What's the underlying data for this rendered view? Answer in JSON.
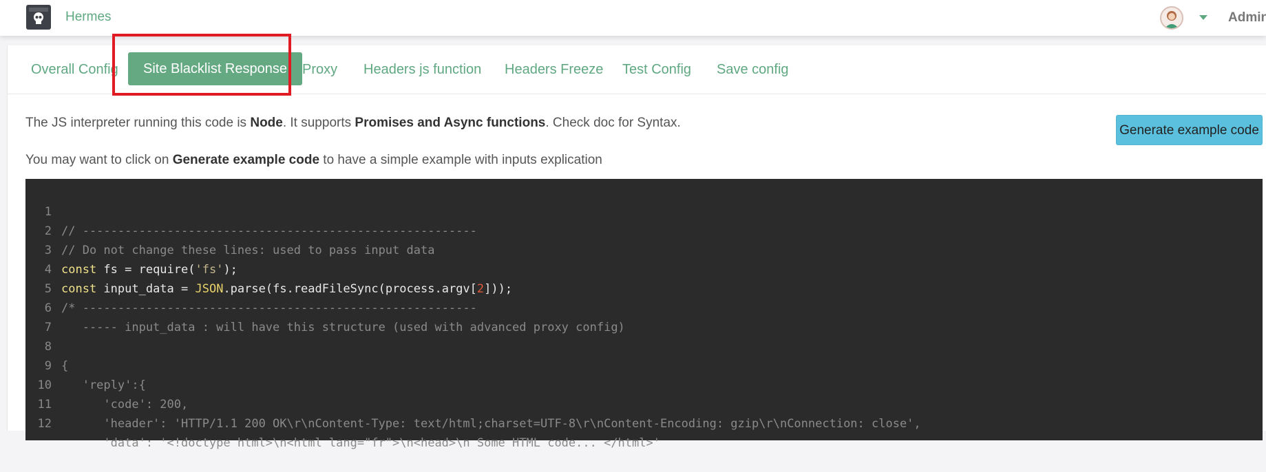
{
  "header": {
    "app_name": "Hermes",
    "user_name": "Admin"
  },
  "tabs": [
    {
      "label": "Overall Config"
    },
    {
      "label": "Site Blacklist Response",
      "active": true
    },
    {
      "label": "Proxy"
    },
    {
      "label": "Headers js function"
    },
    {
      "label": "Headers Freeze"
    },
    {
      "label": "Test Config"
    },
    {
      "label": "Save config"
    }
  ],
  "intro": {
    "line1_a": "The JS interpreter running this code is ",
    "line1_b": "Node",
    "line1_c": ". It supports ",
    "line1_d": "Promises and Async functions",
    "line1_e": ". Check doc for Syntax.",
    "line2_a": "You may want to click on ",
    "line2_b": "Generate example code",
    "line2_c": " to have a simple example with inputs explication"
  },
  "generate_button": "Generate example code",
  "code": {
    "line_numbers": [
      "1",
      "2",
      "3",
      "4",
      "5",
      "6",
      "7",
      "8",
      "9",
      "10",
      "11",
      "12"
    ],
    "l1": "// --------------------------------------------------------",
    "l2": "// Do not change these lines: used to pass input data",
    "l3_kw": "const",
    "l3_a": " fs = require(",
    "l3_str": "'fs'",
    "l3_b": ");",
    "l4_kw": "const",
    "l4_a": " input_data = ",
    "l4_json": "JSON",
    "l4_b": ".parse(fs.readFileSync(process.argv[",
    "l4_num": "2",
    "l4_c": "]));",
    "l5": "/* --------------------------------------------------------",
    "l6": "   ----- input_data : will have this structure (used with advanced proxy config)",
    "l7": "",
    "l8": "{",
    "l9": "   'reply':{",
    "l10": "      'code': 200,",
    "l11": "      'header': 'HTTP/1.1 200 OK\\r\\nContent-Type: text/html;charset=UTF-8\\r\\nContent-Encoding: gzip\\r\\nConnection: close',",
    "l12": "      'data': '<!doctype html>\\n<html lang=\"fr\">\\n<head>\\n Some HTML code... </html>'"
  },
  "colors": {
    "accent": "#5fa882",
    "active_tab_bg": "#64a982",
    "info_button": "#5bc0de",
    "editor_bg": "#2b2b2b",
    "highlight": "#e01b24"
  },
  "icons": {
    "logo": "skull-icon",
    "avatar": "user-avatar-icon",
    "dropdown": "caret-down-icon"
  }
}
